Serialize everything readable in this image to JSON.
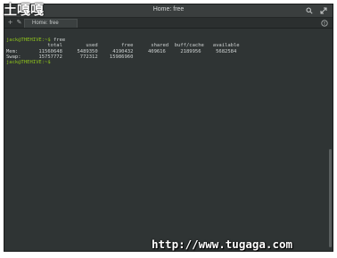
{
  "watermark": {
    "logo_text": "土嘎嘎",
    "url": "http://www.tugaga.com"
  },
  "window": {
    "title": "Home: free"
  },
  "tabs": [
    {
      "label": "Home: free"
    }
  ],
  "icons": {
    "search": "search-icon",
    "fullscreen": "expand-icon",
    "new_tab": "new-tab-icon",
    "edit": "pencil-icon",
    "tab_menu": "circle-menu-icon"
  },
  "terminal": {
    "prompt": "jack@THEHIVE:~$",
    "command": " free",
    "header": "              total        used        free      shared  buff/cache   available",
    "rows": [
      "Mem:       11560648     5489350     4190432     409616     2189956     5682584",
      "Swap:      15757772      772312    15986960"
    ],
    "next_prompt": "jack@THEHIVE:~$",
    "next_command": " "
  },
  "colors": {
    "background": "#2f3434",
    "prompt": "#8ec31c",
    "text": "#cfd3d3"
  }
}
